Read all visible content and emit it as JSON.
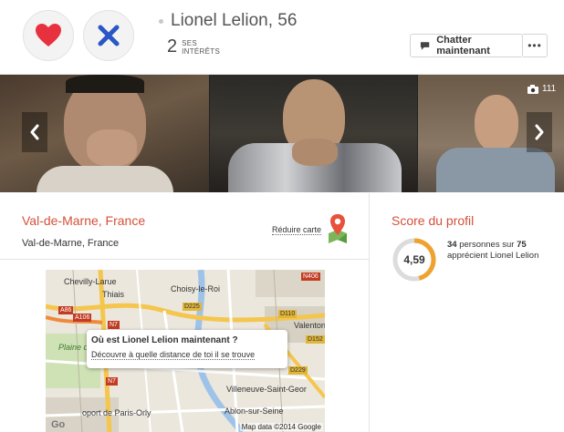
{
  "header": {
    "name": "Lionel Lelion,",
    "age": "56",
    "interests_count": "2",
    "interests_label_1": "SES",
    "interests_label_2": "INTÉRÊTS",
    "chat_label": "Chatter maintenant",
    "more_label": "•••"
  },
  "photos": {
    "count": "111"
  },
  "location": {
    "title": "Val-de-Marne, France",
    "subtitle": "Val-de-Marne, France",
    "reduce_label": "Réduire carte"
  },
  "map": {
    "labels": {
      "chevilly": "Chevilly-Larue",
      "thiais": "Thiais",
      "choisy": "Choisy-le-Roi",
      "valenton": "Valenton",
      "plaine": "Plaine de",
      "villeneuve": "Villeneuve-Saint-Geor",
      "ablon": "Ablon-sur-Seine",
      "orly": "oport de Paris-Orly"
    },
    "roads": {
      "a86": "A86",
      "a106": "A106",
      "n7a": "N7",
      "n7b": "N7",
      "d225": "D225",
      "d110": "D110",
      "d152": "D152",
      "d229": "D229",
      "n406": "N406"
    },
    "popup_title": "Où est Lionel Lelion maintenant ?",
    "popup_link": "Découvre à quelle distance de toi il se trouve",
    "credit": "Map data ©2014 Google",
    "logo": "Go"
  },
  "score": {
    "title": "Score du profil",
    "value": "4,59",
    "value_fraction": 0.459,
    "count": "34",
    "text_mid": "personnes sur",
    "total": "75",
    "text_end": "apprécient Lionel Lelion"
  },
  "colors": {
    "accent": "#d4503a",
    "gauge_orange": "#f0a22e",
    "gauge_yellow": "#f5c542",
    "heart": "#e8313f",
    "cross": "#2a56c6"
  },
  "icons": [
    "heart-icon",
    "cross-icon",
    "chat-bubble-icon",
    "camera-icon",
    "chevron-left-icon",
    "chevron-right-icon",
    "map-pin-icon"
  ]
}
